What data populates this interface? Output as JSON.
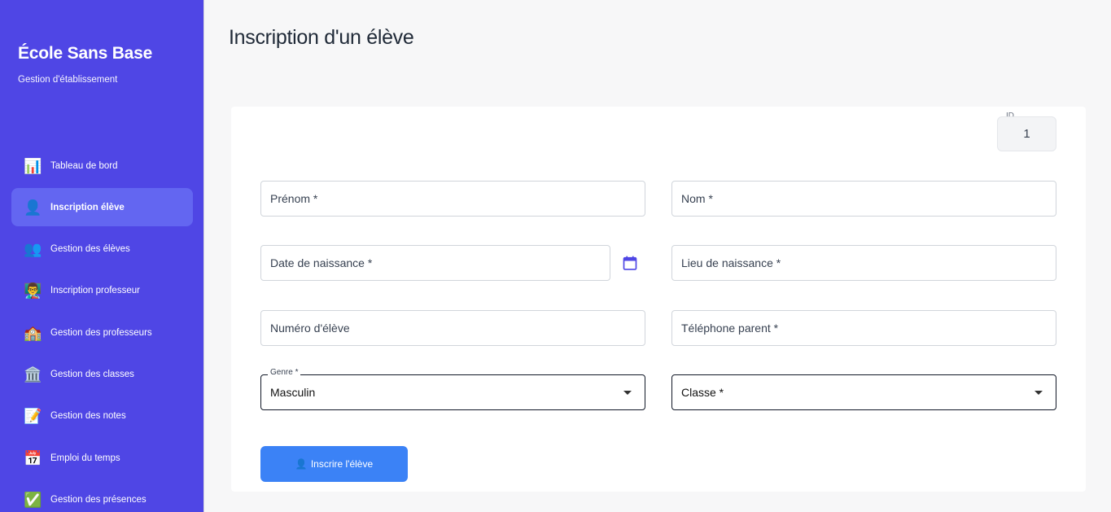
{
  "sidebar": {
    "title": "École Sans Base",
    "subtitle": "Gestion d'établissement",
    "items": [
      {
        "label": "Tableau de bord",
        "icon": "📊",
        "icon_name": "chart-icon"
      },
      {
        "label": "Inscription élève",
        "icon": "👤",
        "icon_name": "user-icon"
      },
      {
        "label": "Gestion des élèves",
        "icon": "👥",
        "icon_name": "users-icon"
      },
      {
        "label": "Inscription professeur",
        "icon": "👨‍🏫",
        "icon_name": "teacher-icon"
      },
      {
        "label": "Gestion des professeurs",
        "icon": "🏫",
        "icon_name": "school-icon"
      },
      {
        "label": "Gestion des classes",
        "icon": "🏛️",
        "icon_name": "building-icon"
      },
      {
        "label": "Gestion des notes",
        "icon": "📝",
        "icon_name": "memo-icon"
      },
      {
        "label": "Emploi du temps",
        "icon": "📅",
        "icon_name": "calendar-icon"
      },
      {
        "label": "Gestion des présences",
        "icon": "✅",
        "icon_name": "check-icon"
      }
    ]
  },
  "main": {
    "title": "Inscription d'un élève"
  },
  "form": {
    "id_label": "ID",
    "id_value": "1",
    "prenom": "Prénom *",
    "nom": "Nom *",
    "date_naissance": "Date de naissance *",
    "lieu_naissance": "Lieu de naissance *",
    "numero_eleve": "Numéro d'élève",
    "telephone_parent": "Téléphone parent *",
    "genre_label": "Genre *",
    "genre_value": "Masculin",
    "classe": "Classe *",
    "submit_icon": "👤",
    "submit_label": "Inscrire l'élève"
  },
  "colors": {
    "sidebar": "#4f46e5",
    "active_item": "#6366f1",
    "button": "#3b82f6"
  }
}
